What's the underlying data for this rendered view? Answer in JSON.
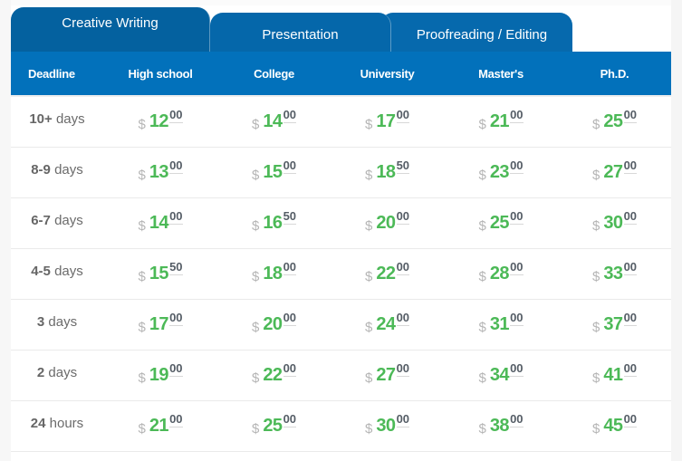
{
  "tabs": [
    {
      "label": "Creative Writing",
      "active": true
    },
    {
      "label": "Presentation",
      "active": false
    },
    {
      "label": "Proofreading / Editing",
      "active": false
    }
  ],
  "colors": {
    "header_bg": "#0271bb",
    "tab_bg": "#0567aa",
    "price_green": "#4cb957",
    "currency_gray": "#b5b5b5"
  },
  "table": {
    "headers": [
      "Deadline",
      "High school",
      "College",
      "University",
      "Master's",
      "Ph.D."
    ],
    "currency": "$",
    "rows": [
      {
        "deadline_num": "10+",
        "deadline_unit": "days",
        "prices": [
          {
            "i": "12",
            "d": "00"
          },
          {
            "i": "14",
            "d": "00"
          },
          {
            "i": "17",
            "d": "00"
          },
          {
            "i": "21",
            "d": "00"
          },
          {
            "i": "25",
            "d": "00"
          }
        ]
      },
      {
        "deadline_num": "8-9",
        "deadline_unit": "days",
        "prices": [
          {
            "i": "13",
            "d": "00"
          },
          {
            "i": "15",
            "d": "00"
          },
          {
            "i": "18",
            "d": "50"
          },
          {
            "i": "23",
            "d": "00"
          },
          {
            "i": "27",
            "d": "00"
          }
        ]
      },
      {
        "deadline_num": "6-7",
        "deadline_unit": "days",
        "prices": [
          {
            "i": "14",
            "d": "00"
          },
          {
            "i": "16",
            "d": "50"
          },
          {
            "i": "20",
            "d": "00"
          },
          {
            "i": "25",
            "d": "00"
          },
          {
            "i": "30",
            "d": "00"
          }
        ]
      },
      {
        "deadline_num": "4-5",
        "deadline_unit": "days",
        "prices": [
          {
            "i": "15",
            "d": "50"
          },
          {
            "i": "18",
            "d": "00"
          },
          {
            "i": "22",
            "d": "00"
          },
          {
            "i": "28",
            "d": "00"
          },
          {
            "i": "33",
            "d": "00"
          }
        ]
      },
      {
        "deadline_num": "3",
        "deadline_unit": "days",
        "prices": [
          {
            "i": "17",
            "d": "00"
          },
          {
            "i": "20",
            "d": "00"
          },
          {
            "i": "24",
            "d": "00"
          },
          {
            "i": "31",
            "d": "00"
          },
          {
            "i": "37",
            "d": "00"
          }
        ]
      },
      {
        "deadline_num": "2",
        "deadline_unit": "days",
        "prices": [
          {
            "i": "19",
            "d": "00"
          },
          {
            "i": "22",
            "d": "00"
          },
          {
            "i": "27",
            "d": "00"
          },
          {
            "i": "34",
            "d": "00"
          },
          {
            "i": "41",
            "d": "00"
          }
        ]
      },
      {
        "deadline_num": "24",
        "deadline_unit": "hours",
        "prices": [
          {
            "i": "21",
            "d": "00"
          },
          {
            "i": "25",
            "d": "00"
          },
          {
            "i": "30",
            "d": "00"
          },
          {
            "i": "38",
            "d": "00"
          },
          {
            "i": "45",
            "d": "00"
          }
        ]
      }
    ]
  }
}
